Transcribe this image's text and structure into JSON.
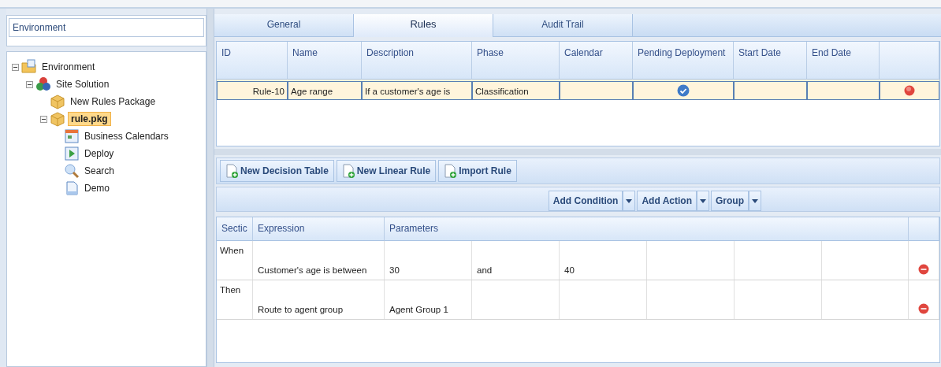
{
  "search_field": {
    "value": "Environment"
  },
  "tree": [
    {
      "label": "Environment",
      "kind": "folder",
      "expanded": true,
      "selected": false,
      "children": [
        {
          "label": "Site Solution",
          "kind": "solution",
          "expanded": true,
          "selected": false,
          "children": [
            {
              "label": "New Rules Package",
              "kind": "package",
              "selected": false
            },
            {
              "label": "rule.pkg",
              "kind": "package",
              "expanded": true,
              "selected": true,
              "children": [
                {
                  "label": "Business Calendars",
                  "kind": "calendar",
                  "selected": false
                },
                {
                  "label": "Deploy",
                  "kind": "deploy",
                  "selected": false
                },
                {
                  "label": "Search",
                  "kind": "search",
                  "selected": false
                },
                {
                  "label": "Demo",
                  "kind": "document",
                  "selected": false
                }
              ]
            }
          ]
        }
      ]
    }
  ],
  "tabs": [
    {
      "label": "General",
      "selected": false
    },
    {
      "label": "Rules",
      "selected": true
    },
    {
      "label": "Audit Trail",
      "selected": false
    }
  ],
  "rules_table": {
    "columns": [
      "ID",
      "Name",
      "Description",
      "Phase",
      "Calendar",
      "Pending Deployment",
      "Start Date",
      "End Date"
    ],
    "rows": [
      {
        "id": "Rule-10",
        "name": "Age range",
        "description": "If a customer's age is",
        "phase": "Classification",
        "pending_deployment": true,
        "selected": true
      }
    ]
  },
  "toolbar": [
    {
      "label": "New Decision Table"
    },
    {
      "label": "New Linear Rule"
    },
    {
      "label": "Import Rule"
    }
  ],
  "actions": [
    {
      "label": "Add Condition"
    },
    {
      "label": "Add Action"
    },
    {
      "label": "Group"
    }
  ],
  "expression_table": {
    "columns": [
      "Sectic",
      "Expression",
      "Parameters"
    ],
    "rows": [
      {
        "section": "When",
        "expression": "Customer's age is between",
        "parameters": [
          "30",
          "and",
          "40"
        ]
      },
      {
        "section": "Then",
        "expression": "Route to agent group",
        "parameters": [
          "Agent Group 1"
        ]
      }
    ]
  }
}
